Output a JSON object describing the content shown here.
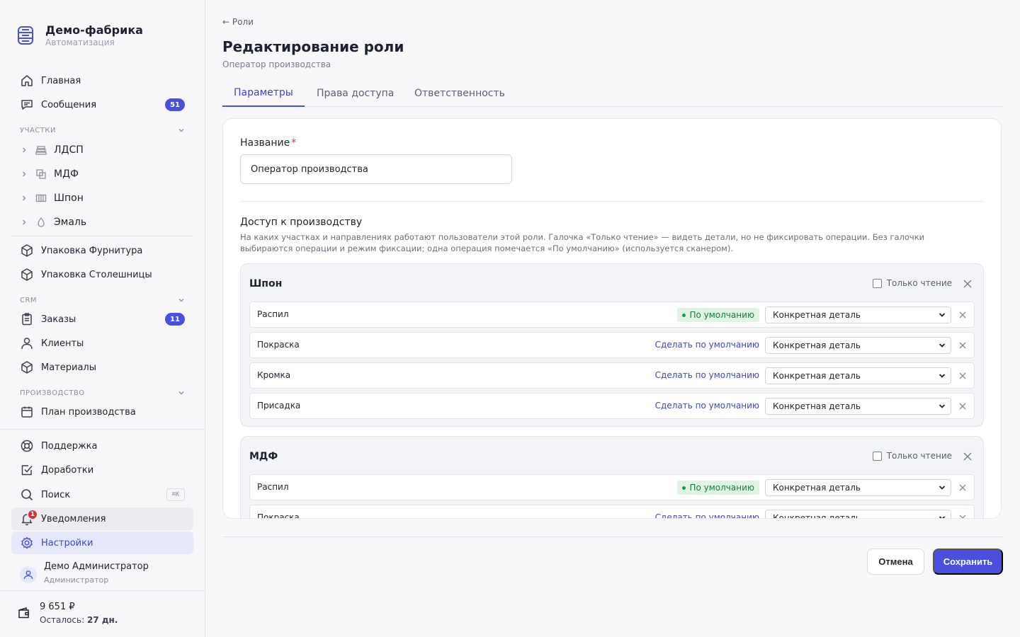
{
  "brand": {
    "title": "Демо-фабрика",
    "subtitle": "Автоматизация"
  },
  "nav": {
    "home": "Главная",
    "messages": "Сообщения",
    "messages_badge": "51",
    "sections": {
      "areas": "УЧАСТКИ",
      "crm": "CRM",
      "production": "ПРОИЗВОДСТВО"
    },
    "areas": [
      "ЛДСП",
      "МДФ",
      "Шпон",
      "Эмаль"
    ],
    "packaging": [
      "Упаковка Фурнитура",
      "Упаковка Столешницы"
    ],
    "orders": "Заказы",
    "orders_badge": "11",
    "clients": "Клиенты",
    "materials": "Материалы",
    "plan": "План производства",
    "support": "Поддержка",
    "improvements": "Доработки",
    "search": "Поиск",
    "search_shortcut": "⌘K",
    "notifications": "Уведомления",
    "notifications_badge": "1",
    "settings": "Настройки"
  },
  "user": {
    "name": "Демо Администратор",
    "role": "Администратор"
  },
  "balance": {
    "amount": "9 651 ₽",
    "left_label": "Осталось:",
    "left_value": "27 дн."
  },
  "page": {
    "back": "← Роли",
    "title": "Редактирование роли",
    "subtitle": "Оператор производства",
    "tabs": [
      "Параметры",
      "Права доступа",
      "Ответственность"
    ],
    "active_tab": "Параметры"
  },
  "form": {
    "name_label": "Название",
    "required_mark": "*",
    "name_value": "Оператор производства",
    "access_title": "Доступ к производству",
    "access_desc": "На каких участках и направлениях работают пользователи этой роли. Галочка «Только чтение» — видеть детали, но не фиксировать операции. Без галочки выбираются операции и режим фиксации; одна операция помечается «По умолчанию» (используется сканером).",
    "readonly_label": "Только чтение",
    "default_label": "По умолчанию",
    "make_default_label": "Сделать по умолчанию",
    "groups": [
      {
        "title": "Шпон",
        "readonly": false,
        "ops": [
          {
            "name": "Распил",
            "is_default": true,
            "mode": "Конкретная деталь"
          },
          {
            "name": "Покраска",
            "is_default": false,
            "mode": "Конкретная деталь"
          },
          {
            "name": "Кромка",
            "is_default": false,
            "mode": "Конкретная деталь"
          },
          {
            "name": "Присадка",
            "is_default": false,
            "mode": "Конкретная деталь"
          }
        ]
      },
      {
        "title": "МДФ",
        "readonly": false,
        "ops": [
          {
            "name": "Распил",
            "is_default": true,
            "mode": "Конкретная деталь"
          },
          {
            "name": "Покраска",
            "is_default": false,
            "mode": "Конкретная деталь"
          }
        ]
      }
    ]
  },
  "actions": {
    "cancel": "Отмена",
    "save": "Сохранить"
  },
  "colors": {
    "accent": "#4b4fe0",
    "danger": "#d92d3a",
    "success_bg": "#dff4e4",
    "success_text": "#1f7a3e"
  }
}
